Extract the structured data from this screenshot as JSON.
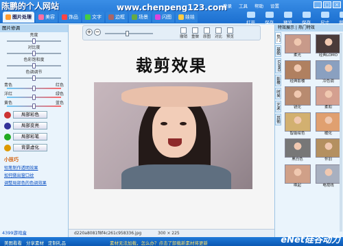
{
  "watermark": {
    "brand": "陈鹏的个人网站",
    "url": "www.chenpeng123.com",
    "corner": "eNet硅谷动力"
  },
  "menu": [
    "登录",
    "工具",
    "帮助",
    "设置"
  ],
  "winbtns": [
    "_",
    "□",
    "×"
  ],
  "tabs": [
    {
      "label": "图片处理",
      "color": "#ff9b2f"
    },
    {
      "label": "美容",
      "color": "#ff6fa2"
    },
    {
      "label": "饰品",
      "color": "#f44"
    },
    {
      "label": "文字",
      "color": "#4c4"
    },
    {
      "label": "边框",
      "color": "#a66"
    },
    {
      "label": "场景",
      "color": "#6a4"
    },
    {
      "label": "闪图",
      "color": "#d4d"
    },
    {
      "label": "娃娃",
      "color": "#fc4"
    }
  ],
  "actions": [
    "打开",
    "保存",
    "预览",
    "保存",
    "尺寸",
    "裁剪"
  ],
  "left": {
    "header": "图片修调",
    "sliders": [
      {
        "label": "亮度",
        "value": 0.5
      },
      {
        "label": "对比度",
        "value": 0.5
      },
      {
        "label": "色彩饱和度",
        "value": 0.5
      },
      {
        "label": "色调调节",
        "value": 0.5
      }
    ],
    "color_sliders": [
      {
        "l": "青色",
        "r": "红色",
        "value": 0.5
      },
      {
        "l": "洋红",
        "r": "绿色",
        "value": 0.5
      },
      {
        "l": "黄色",
        "r": "蓝色",
        "value": 0.5
      }
    ],
    "buttons": [
      {
        "label": "局部彩色",
        "color": "#c33"
      },
      {
        "label": "局部变亮",
        "color": "#339"
      },
      {
        "label": "局部彩笔",
        "color": "#2a2"
      },
      {
        "label": "背景虚化",
        "color": "#d90"
      }
    ],
    "tips_title": "小技巧",
    "tips": [
      "铅笔制作透明效果",
      "如何做出窗口纹",
      "调整局部色的色调效果"
    ],
    "footer": "4399游戏盒"
  },
  "toolbar": {
    "tools": [
      "撤销",
      "重做",
      "原图",
      "对比",
      "预览"
    ]
  },
  "canvas": {
    "title": "裁剪效果"
  },
  "status": {
    "filename": "d220a8081f8f4c261c958336.jpg",
    "dimensions": "300 × 225"
  },
  "right": {
    "header": "特效展示 | 热门特效",
    "tabs": [
      "热门",
      "基础",
      "LOMO",
      "影楼",
      "时尚",
      "艺术",
      "其他"
    ],
    "thumbs": [
      {
        "cap": "柔光",
        "color": "#c89a8a"
      },
      {
        "cap": "经典LOMO",
        "color": "#4a3b3a"
      },
      {
        "cap": "经典影楼",
        "color": "#b08060"
      },
      {
        "cap": "冷色调",
        "color": "#8aa0c0"
      },
      {
        "cap": "锐化",
        "color": "#b88b70"
      },
      {
        "cap": "柔和",
        "color": "#d4a090"
      },
      {
        "cap": "智能绘色",
        "color": "#d2b070"
      },
      {
        "cap": "暖化",
        "color": "#e0a070"
      },
      {
        "cap": "黑白色",
        "color": "#777777"
      },
      {
        "cap": "怀旧",
        "color": "#b49060"
      },
      {
        "cap": "唤起",
        "color": "#d0a088"
      },
      {
        "cap": "电视线",
        "color": "#a8b0c0"
      }
    ]
  },
  "footer": {
    "items": [
      "美图看看",
      "分享素材",
      "定制礼品"
    ],
    "msg": "素材无法加载，怎么办？点击了卸载新素材将更新"
  }
}
